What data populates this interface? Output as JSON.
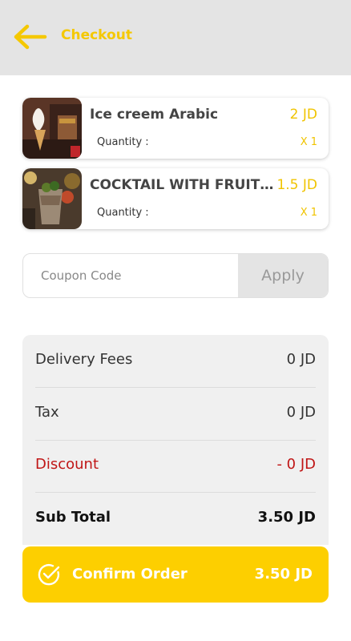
{
  "header": {
    "title": "Checkout",
    "back_icon": "arrow-left-icon"
  },
  "items": [
    {
      "name": "Ice creem Arabic",
      "price": "2 JD",
      "quantity_label": "Quantity :",
      "quantity": "X 1"
    },
    {
      "name": "COCKTAIL WITH FRUIT…",
      "price": "1.5 JD",
      "quantity_label": "Quantity :",
      "quantity": "X 1"
    }
  ],
  "coupon": {
    "placeholder": "Coupon Code",
    "apply_label": "Apply"
  },
  "summary": {
    "delivery_label": "Delivery Fees",
    "delivery_value": "0 JD",
    "tax_label": "Tax",
    "tax_value": "0 JD",
    "discount_label": "Discount",
    "discount_value": "- 0 JD",
    "subtotal_label": "Sub Total",
    "subtotal_value": "3.50 JD"
  },
  "confirm": {
    "label": "Confirm Order",
    "total": "3.50 JD",
    "icon": "check-circle-icon"
  },
  "colors": {
    "accent": "#fdcf00",
    "discount": "#c01616",
    "header_bg": "#e4e4e4"
  }
}
